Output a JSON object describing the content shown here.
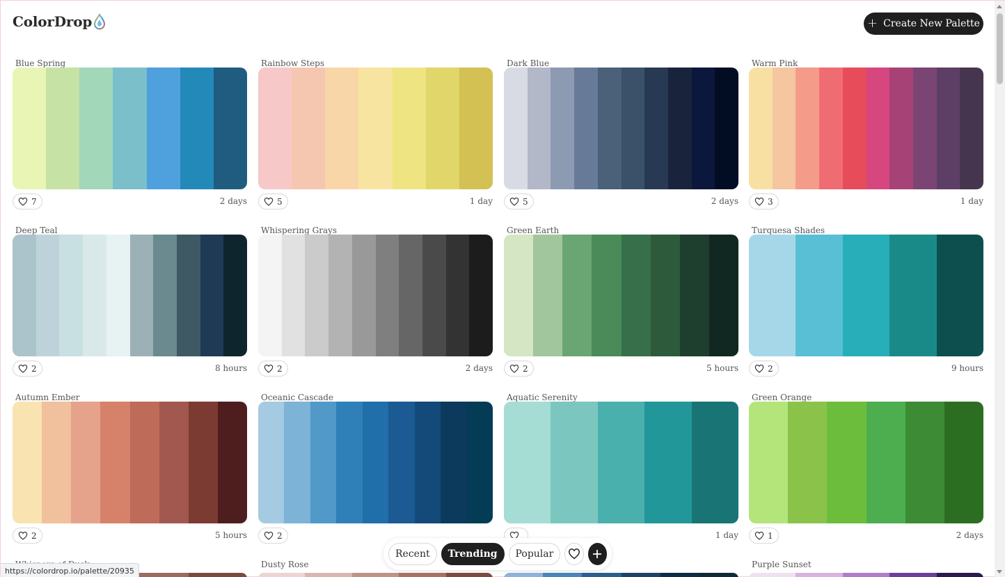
{
  "app": {
    "logo_text": "ColorDrop",
    "create_button_label": "Create New Palette"
  },
  "palettes": [
    {
      "title": "Blue Spring",
      "likes": "7",
      "time": "2 days",
      "colors": [
        "#e8f5b4",
        "#c6e2a5",
        "#a2d7ba",
        "#7bbfca",
        "#4fa1dd",
        "#2389b9",
        "#1f5c80"
      ]
    },
    {
      "title": "Rainbow Steps",
      "likes": "5",
      "time": "1 day",
      "colors": [
        "#f6c8c8",
        "#f6c7b0",
        "#f8d6a8",
        "#f7e4a0",
        "#efe482",
        "#e1d66a",
        "#d3c154"
      ]
    },
    {
      "title": "Dark Blue",
      "likes": "5",
      "time": "2 days",
      "colors": [
        "#d9dbe4",
        "#b2b8c8",
        "#8c9ab2",
        "#677b98",
        "#4b6079",
        "#3b5169",
        "#283a53",
        "#19233c",
        "#0b173d",
        "#020d23"
      ]
    },
    {
      "title": "Warm Pink",
      "likes": "3",
      "time": "1 day",
      "colors": [
        "#f7e0a2",
        "#f5c69f",
        "#f49b8a",
        "#f06c73",
        "#e74c5b",
        "#d6467f",
        "#a64275",
        "#7a4572",
        "#5d3f66",
        "#46354f"
      ]
    },
    {
      "title": "Deep Teal",
      "likes": "2",
      "time": "8 hours",
      "colors": [
        "#abc3cb",
        "#bdd3d9",
        "#c8e0e2",
        "#d9e9e9",
        "#e7f2f3",
        "#9cb1b5",
        "#6a8a8f",
        "#3e5964",
        "#1f3a54",
        "#0f252d"
      ]
    },
    {
      "title": "Whispering Grays",
      "likes": "2",
      "time": "2 days",
      "colors": [
        "#f4f4f4",
        "#e1e1e1",
        "#cbcbcb",
        "#b3b3b3",
        "#999999",
        "#7f7f7f",
        "#666666",
        "#4a4a4a",
        "#333333",
        "#1c1c1c"
      ]
    },
    {
      "title": "Green Earth",
      "likes": "2",
      "time": "5 hours",
      "colors": [
        "#d4e6c3",
        "#a1c69d",
        "#6aa574",
        "#4a8b59",
        "#376f4a",
        "#2c5a3b",
        "#1e3e2e",
        "#112822"
      ]
    },
    {
      "title": "Turquesa Shades",
      "likes": "2",
      "time": "9 hours",
      "colors": [
        "#a5d7e9",
        "#58bfd5",
        "#27aeb8",
        "#1a8a89",
        "#0d4f4f"
      ]
    },
    {
      "title": "Autumn Ember",
      "likes": "2",
      "time": "5 hours",
      "colors": [
        "#f9e3b1",
        "#f1c09c",
        "#e4a38a",
        "#d6826a",
        "#bf6b5a",
        "#a2584e",
        "#7b3b33",
        "#4d1e1d"
      ]
    },
    {
      "title": "Oceanic Cascade",
      "likes": "2",
      "time": "",
      "colors": [
        "#a5cbe2",
        "#7cb3d6",
        "#5199c9",
        "#2f80b9",
        "#216faa",
        "#1b5a93",
        "#134a79",
        "#0c3a5d",
        "#033c54"
      ]
    },
    {
      "title": "Aquatic Serenity",
      "likes": "",
      "time": "1 day",
      "colors": [
        "#a5dcd3",
        "#7cc6c0",
        "#4ab0ae",
        "#22979a",
        "#197575"
      ]
    },
    {
      "title": "Green Orange",
      "likes": "1",
      "time": "2 days",
      "colors": [
        "#b3e57a",
        "#8bc34a",
        "#6dbd3d",
        "#4cae4f",
        "#3d8b34",
        "#2c6e21"
      ]
    }
  ],
  "partial_palettes": [
    {
      "title": "Whispers of Dusk",
      "colors": [
        "#d9bfb8",
        "#c79c90",
        "#9a6a60",
        "#7a4a40"
      ]
    },
    {
      "title": "Dusty Rose",
      "colors": [
        "#ecd4d2",
        "#d9b6b2",
        "#bf9289",
        "#a77068",
        "#7d4b45"
      ]
    },
    {
      "title": "",
      "colors": [
        "#8fb3d9",
        "#4b85b9",
        "#2c5f8e",
        "#1d4466",
        "#0d2c45",
        "#0e2a36"
      ]
    },
    {
      "title": "Purple Sunset",
      "colors": [
        "#efe1ee",
        "#d8b3dd",
        "#b07dc8",
        "#6d3f9a",
        "#2b1a4d"
      ]
    }
  ],
  "bottom_nav": {
    "recent": "Recent",
    "trending": "Trending",
    "popular": "Popular"
  },
  "status_url": "https://colordrop.io/palette/20935"
}
